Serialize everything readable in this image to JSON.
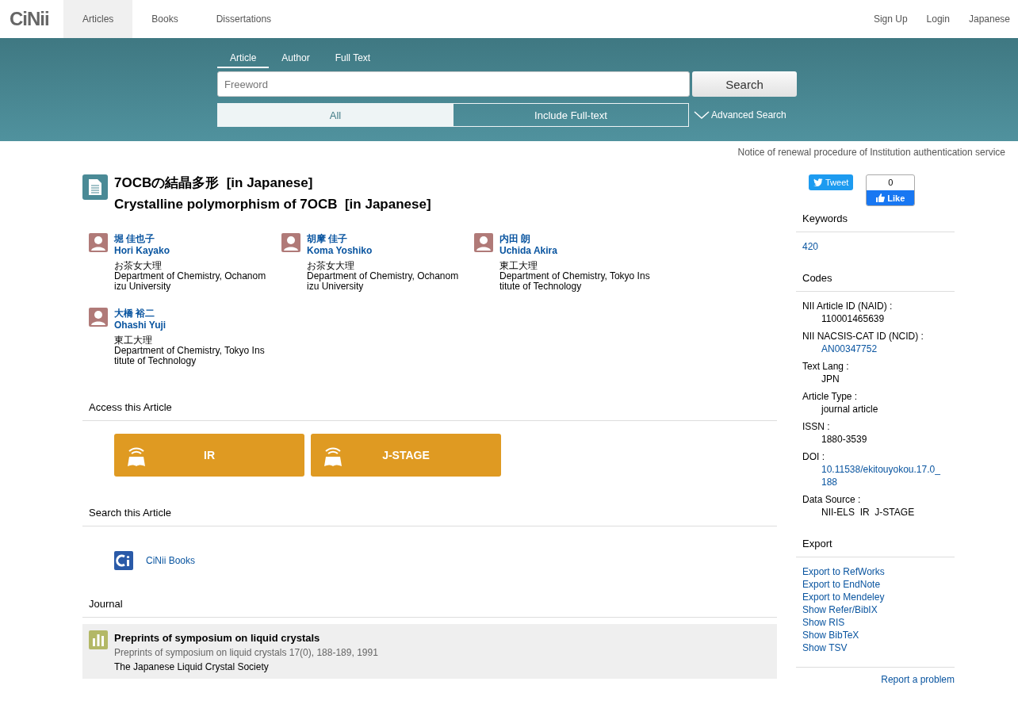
{
  "logo": "CiNii",
  "nav": [
    {
      "label": "Articles",
      "selected": true
    },
    {
      "label": "Books",
      "selected": false
    },
    {
      "label": "Dissertations",
      "selected": false
    }
  ],
  "nav_right": [
    "Sign Up",
    "Login",
    "Japanese"
  ],
  "search": {
    "tabs": [
      {
        "label": "Article",
        "selected": true
      },
      {
        "label": "Author",
        "selected": false
      },
      {
        "label": "Full Text",
        "selected": false
      }
    ],
    "placeholder": "Freeword",
    "button": "Search",
    "scope": [
      {
        "label": "All",
        "selected": true
      },
      {
        "label": "Include Full-text",
        "selected": false
      }
    ],
    "advanced": "Advanced Search"
  },
  "notice": "Notice of renewal procedure of Institution authentication service",
  "article": {
    "title_ja": "7OCBの結晶多形  [in Japanese]",
    "title_en": "Crystalline polymorphism of 7OCB  [in Japanese]",
    "authors": [
      {
        "name_ja": "堀 佳也子",
        "name_en": "Hori Kayako",
        "affil_ja": "お茶女大理",
        "affil_en": "Department of Chemistry, Ochanomizu University"
      },
      {
        "name_ja": "胡摩 佳子",
        "name_en": "Koma Yoshiko",
        "affil_ja": "お茶女大理",
        "affil_en": "Department of Chemistry, Ochanomizu University"
      },
      {
        "name_ja": "内田 朗",
        "name_en": "Uchida Akira",
        "affil_ja": "東工大理",
        "affil_en": "Department of Chemistry, Tokyo Institute of Technology"
      },
      {
        "name_ja": "大橋 裕二",
        "name_en": "Ohashi Yuji",
        "affil_ja": "東工大理",
        "affil_en": "Department of Chemistry, Tokyo Institute of Technology"
      }
    ]
  },
  "access": {
    "heading": "Access this Article",
    "buttons": [
      "IR",
      "J-STAGE"
    ]
  },
  "search_article": {
    "heading": "Search this Article",
    "links": [
      "CiNii Books"
    ]
  },
  "journal": {
    "heading": "Journal",
    "title": "Preprints of symposium on liquid crystals",
    "citation": "Preprints of symposium on liquid crystals 17(0), 188-189, 1991",
    "publisher": "The Japanese Liquid Crystal Society"
  },
  "social": {
    "tweet": "Tweet",
    "like_count": "0",
    "like": "Like"
  },
  "keywords": {
    "heading": "Keywords",
    "items": [
      "420"
    ]
  },
  "codes": {
    "heading": "Codes",
    "items": [
      {
        "label": "NII Article ID (NAID) :",
        "value": "110001465639",
        "kind": "text"
      },
      {
        "label": "NII NACSIS-CAT ID (NCID) :",
        "value": "AN00347752",
        "kind": "link"
      },
      {
        "label": "Text Lang :",
        "value": "JPN",
        "kind": "text"
      },
      {
        "label": "Article Type :",
        "value": "journal article",
        "kind": "text"
      },
      {
        "label": "ISSN :",
        "value": "1880-3539",
        "kind": "text"
      },
      {
        "label": "DOI :",
        "value": "10.11538/ekitouyokou.17.0_188",
        "kind": "link"
      },
      {
        "label": "Data Source :",
        "value": "NII-ELS  IR  J-STAGE",
        "kind": "text"
      }
    ]
  },
  "export": {
    "heading": "Export",
    "links": [
      "Export to RefWorks",
      "Export to EndNote",
      "Export to Mendeley",
      "Show Refer/BibIX",
      "Show RIS",
      "Show BibTeX",
      "Show TSV"
    ]
  },
  "report": "Report a problem"
}
